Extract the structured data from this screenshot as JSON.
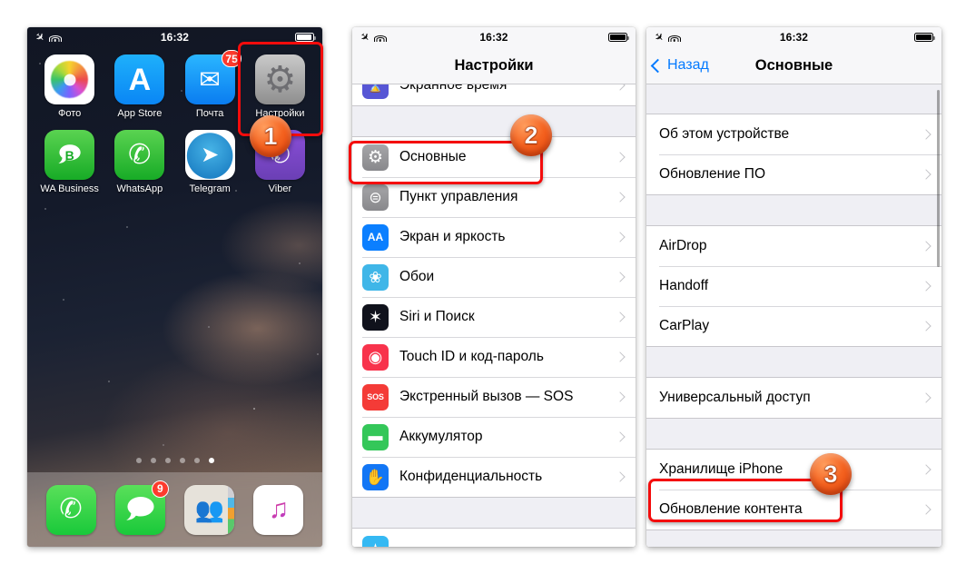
{
  "home": {
    "status": {
      "time": "16:32",
      "airplane_icon": "airplane-mode-icon",
      "wifi_icon": "wifi-icon",
      "battery_icon": "battery-icon"
    },
    "apps": [
      {
        "label": "Фото",
        "icon": "photos-icon",
        "badge": null
      },
      {
        "label": "App Store",
        "icon": "app-store-icon",
        "badge": null
      },
      {
        "label": "Почта",
        "icon": "mail-icon",
        "badge": "75"
      },
      {
        "label": "Настройки",
        "icon": "settings-icon",
        "badge": null
      },
      {
        "label": "WA Business",
        "icon": "whatsapp-business-icon",
        "badge": null
      },
      {
        "label": "WhatsApp",
        "icon": "whatsapp-icon",
        "badge": null
      },
      {
        "label": "Telegram",
        "icon": "telegram-icon",
        "badge": null
      },
      {
        "label": "Viber",
        "icon": "viber-icon",
        "badge": null
      }
    ],
    "page_dots": {
      "count": 6,
      "active_index": 5
    },
    "dock": [
      {
        "label": "Телефон",
        "icon": "phone-icon",
        "badge": null
      },
      {
        "label": "Сообщения",
        "icon": "messages-icon",
        "badge": "9"
      },
      {
        "label": "Контакты",
        "icon": "contacts-icon",
        "badge": null
      },
      {
        "label": "Музыка",
        "icon": "music-icon",
        "badge": null
      }
    ]
  },
  "settings": {
    "status": {
      "time": "16:32"
    },
    "title": "Настройки",
    "rows": [
      {
        "label": "Экранное время",
        "icon": "screen-time-icon",
        "icon_glyph": "⌛",
        "icon_class": "i-screentime",
        "partial_top": true
      },
      {
        "label": "Основные",
        "icon": "general-gear-icon",
        "icon_glyph": "⚙",
        "icon_class": "i-general",
        "highlighted": true
      },
      {
        "label": "Пункт управления",
        "icon": "control-center-icon",
        "icon_glyph": "◎",
        "icon_class": "i-control"
      },
      {
        "label": "Экран и яркость",
        "icon": "display-brightness-icon",
        "icon_glyph": "AA",
        "icon_class": "i-display"
      },
      {
        "label": "Обои",
        "icon": "wallpaper-icon",
        "icon_glyph": "❀",
        "icon_class": "i-wallpaper"
      },
      {
        "label": "Siri и Поиск",
        "icon": "siri-icon",
        "icon_glyph": "✦",
        "icon_class": "i-siri"
      },
      {
        "label": "Touch ID и код-пароль",
        "icon": "touch-id-icon",
        "icon_glyph": "◉",
        "icon_class": "i-touchid"
      },
      {
        "label": "Экстренный вызов — SOS",
        "icon": "emergency-sos-icon",
        "icon_glyph": "SOS",
        "icon_class": "i-sos"
      },
      {
        "label": "Аккумулятор",
        "icon": "battery-settings-icon",
        "icon_glyph": "▭",
        "icon_class": "i-battery"
      },
      {
        "label": "Конфиденциальность",
        "icon": "privacy-hand-icon",
        "icon_glyph": "✋",
        "icon_class": "i-privacy"
      }
    ]
  },
  "general": {
    "status": {
      "time": "16:32"
    },
    "back_label": "Назад",
    "title": "Основные",
    "groups": [
      {
        "rows": [
          {
            "label": "Об этом устройстве"
          },
          {
            "label": "Обновление ПО"
          }
        ]
      },
      {
        "rows": [
          {
            "label": "AirDrop"
          },
          {
            "label": "Handoff"
          },
          {
            "label": "CarPlay"
          }
        ]
      },
      {
        "rows": [
          {
            "label": "Универсальный доступ"
          }
        ]
      },
      {
        "rows": [
          {
            "label": "Хранилище iPhone",
            "highlighted": true
          },
          {
            "label": "Обновление контента"
          }
        ]
      }
    ]
  },
  "annotations": {
    "steps": [
      {
        "number": "1",
        "target": "settings-app-icon"
      },
      {
        "number": "2",
        "target": "settings-row-general"
      },
      {
        "number": "3",
        "target": "general-row-iphone-storage"
      }
    ],
    "highlight_color": "#f40c0c",
    "bubble_color": "#f4621f"
  }
}
